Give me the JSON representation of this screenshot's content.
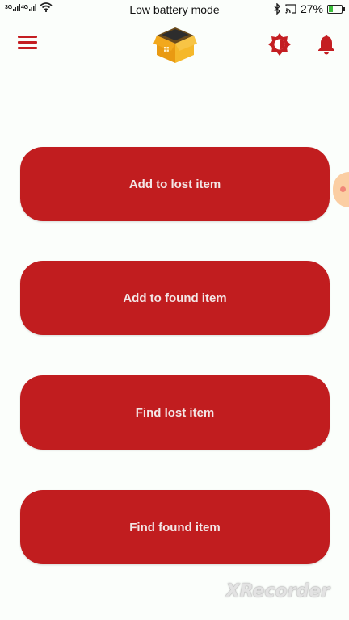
{
  "status_bar": {
    "network_1": "3G",
    "network_2": "4G",
    "center_text": "Low battery mode",
    "battery_percent": "27%",
    "icons": [
      "signal-icon",
      "wifi-icon",
      "bluetooth-icon",
      "cast-icon",
      "battery-icon"
    ]
  },
  "app_bar": {
    "menu_icon": "hamburger-menu-icon",
    "logo_icon": "box-logo-icon",
    "theme_icon": "brightness-toggle-icon",
    "notification_icon": "bell-icon",
    "accent_color": "#c41e22"
  },
  "actions": [
    {
      "label": "Add to lost item"
    },
    {
      "label": "Add to found item"
    },
    {
      "label": "Find lost item"
    },
    {
      "label": "Find found item"
    }
  ],
  "watermark": "XRecorder",
  "colors": {
    "button_bg": "#c11d1f",
    "button_text": "#f3e6e6",
    "background": "#fbfefb"
  }
}
